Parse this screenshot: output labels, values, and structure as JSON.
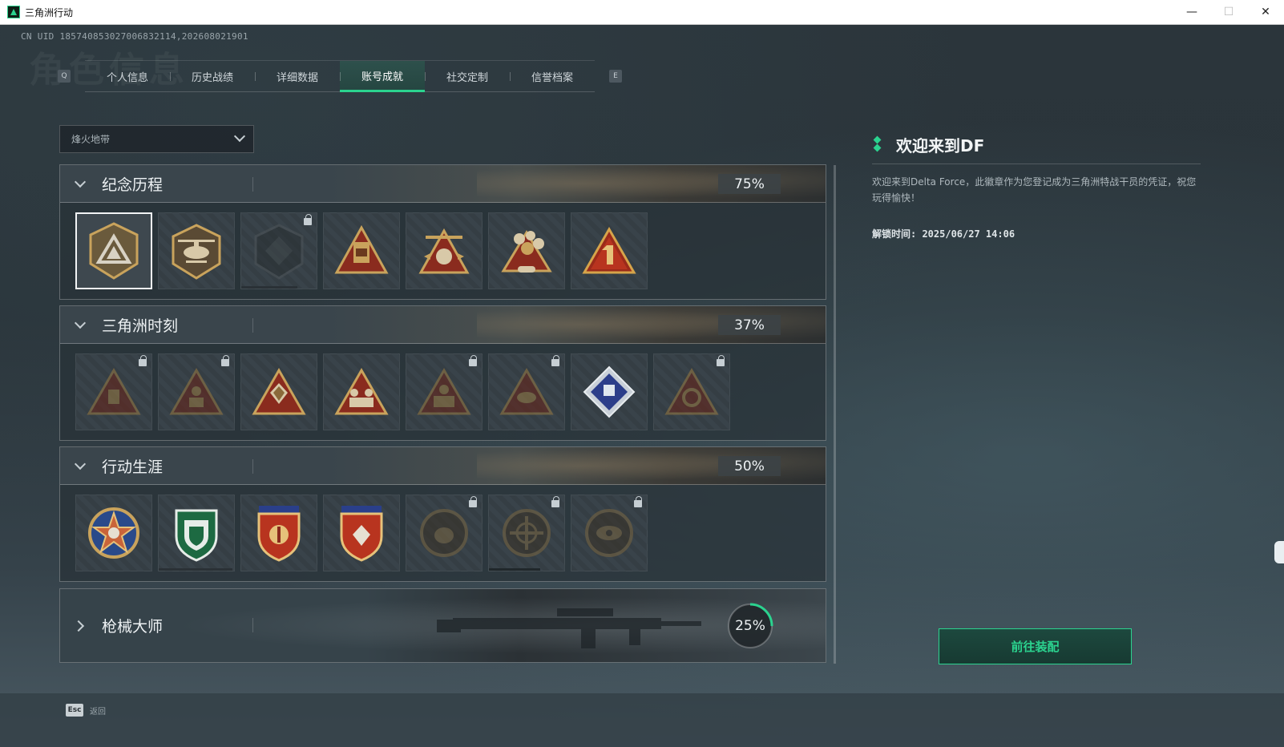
{
  "window": {
    "title": "三角洲行动",
    "controls": [
      "—",
      "☐",
      "✕"
    ]
  },
  "header": {
    "uid": "CN UID 1857408530270068321​14,202608021901",
    "watermark": "角色信息"
  },
  "tabs": {
    "prev_key": "Q",
    "next_key": "E",
    "items": [
      {
        "label": "个人信息"
      },
      {
        "label": "历史战绩"
      },
      {
        "label": "详细数据"
      },
      {
        "label": "账号成就",
        "active": true
      },
      {
        "label": "社交定制"
      },
      {
        "label": "信誉档案"
      }
    ]
  },
  "mode_select": {
    "value": "烽火地带"
  },
  "categories": [
    {
      "title": "纪念历程",
      "progress": "75%",
      "expanded": true,
      "badges": [
        {
          "icon": "delta-logo-badge-icon",
          "locked": false,
          "selected": true
        },
        {
          "icon": "helicopter-badge-icon",
          "locked": false
        },
        {
          "icon": "dark-emblem-badge-icon",
          "locked": true
        },
        {
          "icon": "s7-backpack-badge-icon",
          "locked": false
        },
        {
          "icon": "s5-star-badge-icon",
          "locked": false
        },
        {
          "icon": "s10-eagle-badge-icon",
          "locked": false
        },
        {
          "icon": "number-one-badge-icon",
          "locked": false
        }
      ]
    },
    {
      "title": "三角洲时刻",
      "progress": "37%",
      "expanded": true,
      "badges": [
        {
          "icon": "crate-triangle-badge-icon",
          "locked": true
        },
        {
          "icon": "soldier-triangle-badge-icon",
          "locked": true
        },
        {
          "icon": "crystal-triangle-badge-icon",
          "locked": false
        },
        {
          "icon": "squad-triangle-badge-icon",
          "locked": false
        },
        {
          "icon": "medic-triangle-badge-icon",
          "locked": true
        },
        {
          "icon": "fish-triangle-badge-icon",
          "locked": true
        },
        {
          "icon": "blue-diamond-badge-icon",
          "locked": false
        },
        {
          "icon": "snake-triangle-badge-icon",
          "locked": true
        }
      ]
    },
    {
      "title": "行动生涯",
      "progress": "50%",
      "expanded": true,
      "badges": [
        {
          "icon": "star-medal-badge-icon",
          "locked": false
        },
        {
          "icon": "green-shield-badge-icon",
          "locked": false
        },
        {
          "icon": "red-shield-badge-icon",
          "locked": false
        },
        {
          "icon": "red-shield-gem-badge-icon",
          "locked": false
        },
        {
          "icon": "circle-medal-badge-icon",
          "locked": true
        },
        {
          "icon": "crosshair-medal-badge-icon",
          "locked": true
        },
        {
          "icon": "eye-medal-badge-icon",
          "locked": true
        }
      ]
    },
    {
      "title": "枪械大师",
      "progress": "25%",
      "expanded": false
    }
  ],
  "detail": {
    "title": "欢迎来到DF",
    "description": "欢迎来到Delta Force，此徽章作为您登记成为三角洲特战干员的凭证，祝您玩得愉快！",
    "unlock_time": "解锁时间: 2025/06/27 14:06"
  },
  "actions": {
    "equip_label": "前往装配"
  },
  "footer": {
    "esc_key": "Esc",
    "back_label": "返回"
  },
  "colors": {
    "accent": "#2bd38f",
    "gold": "#c9a35c",
    "red": "#8a2b1e"
  }
}
